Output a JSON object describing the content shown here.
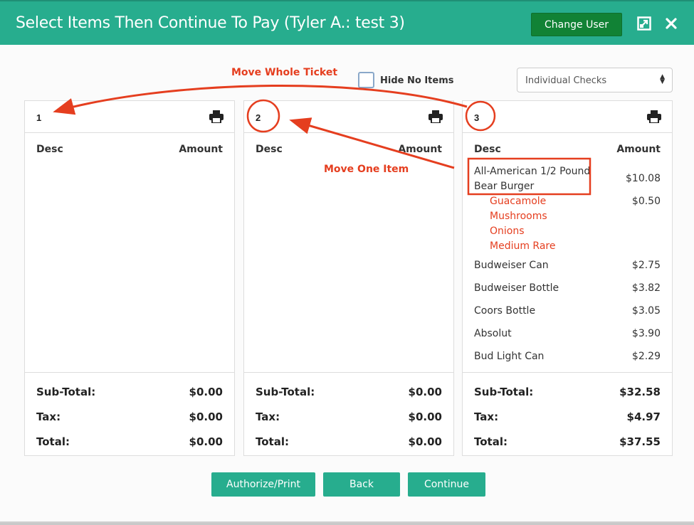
{
  "header": {
    "title": "Select Items Then Continue To Pay (Tyler A.: test 3)",
    "change_user_label": "Change User",
    "expand_icon": "expand-icon",
    "close_icon": "close-icon"
  },
  "controls": {
    "hide_no_items_label": "Hide No Items",
    "hide_no_items_checked": false,
    "split_mode": "Individual Checks"
  },
  "columns": {
    "desc": "Desc",
    "amount": "Amount"
  },
  "totals_labels": {
    "subtotal": "Sub-Total:",
    "tax": "Tax:",
    "total": "Total:"
  },
  "checks": [
    {
      "number": "1",
      "items": [],
      "subtotal": "$0.00",
      "tax": "$0.00",
      "total": "$0.00"
    },
    {
      "number": "2",
      "items": [],
      "subtotal": "$0.00",
      "tax": "$0.00",
      "total": "$0.00"
    },
    {
      "number": "3",
      "items": [
        {
          "desc_line1": "All-American 1/2 Pound",
          "desc_line2": "Bear Burger",
          "amount": "$10.08"
        },
        {
          "modifiers": [
            "Guacamole",
            "Mushrooms",
            "Onions",
            "Medium Rare"
          ],
          "amount": "$0.50"
        },
        {
          "desc": "Budweiser Can",
          "amount": "$2.75"
        },
        {
          "desc": "Budweiser Bottle",
          "amount": "$3.82"
        },
        {
          "desc": "Coors Bottle",
          "amount": "$3.05"
        },
        {
          "desc": "Absolut",
          "amount": "$3.90"
        },
        {
          "desc": "Bud Light Can",
          "amount": "$2.29"
        }
      ],
      "subtotal": "$32.58",
      "tax": "$4.97",
      "total": "$37.55"
    }
  ],
  "footer": {
    "authorize_label": "Authorize/Print",
    "back_label": "Back",
    "continue_label": "Continue"
  },
  "annotations": {
    "move_whole_ticket": "Move Whole Ticket",
    "move_one_item": "Move One Item"
  },
  "colors": {
    "header": "#27ad8e",
    "change_user": "#118235",
    "annotation": "#e53e1f",
    "modifier": "#e53e1f"
  }
}
